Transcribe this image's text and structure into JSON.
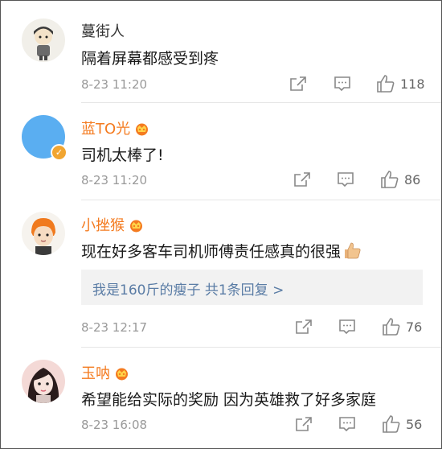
{
  "comments": [
    {
      "username": "蔓街人",
      "text": "隔着屏幕都感受到疼",
      "time": "8-23 11:20",
      "likes": "118",
      "verified": false,
      "vip": false,
      "reply_summary": ""
    },
    {
      "username": "蓝TO光",
      "text": "司机太棒了!",
      "time": "8-23 11:20",
      "likes": "86",
      "verified": true,
      "vip": true,
      "reply_summary": ""
    },
    {
      "username": "小挫猴",
      "text": "现在好多客车司机师傅责任感真的很强",
      "text_emoji": "thumbs-up",
      "time": "8-23 12:17",
      "likes": "76",
      "verified": false,
      "vip": true,
      "reply_summary": "我是160斤的瘦子  共1条回复 >"
    },
    {
      "username": "玉呐",
      "text": "希望能给实际的奖励 因为英雄救了好多家庭",
      "time": "8-23 16:08",
      "likes": "56",
      "verified": false,
      "vip": true,
      "reply_summary": ""
    }
  ],
  "colors": {
    "vip_name": "#f47b20",
    "reply_link": "#5a7ca5",
    "meta": "#999999"
  },
  "icons": [
    "share-icon",
    "comment-icon",
    "like-icon",
    "vip-crown-icon",
    "verified-icon"
  ]
}
